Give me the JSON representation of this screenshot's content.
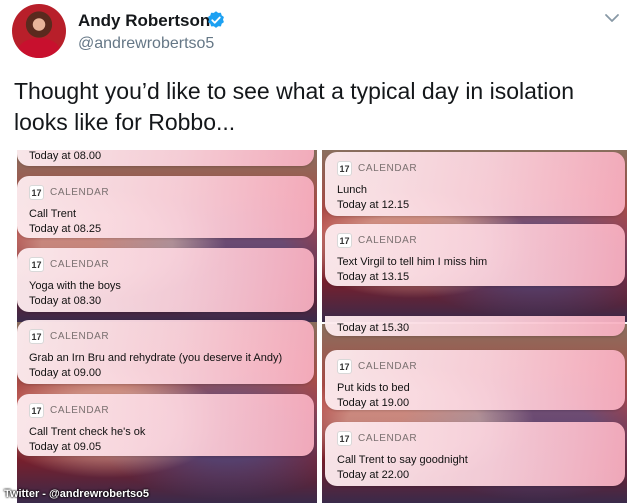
{
  "profile": {
    "name": "Andy Robertson",
    "handle": "@andrewrobertso5",
    "verified_icon": "verified-badge-icon",
    "menu_icon": "chevron-down-icon"
  },
  "tweet": {
    "text": "Thought you’d like to see what a typical day in isolation looks like for Robbo..."
  },
  "media": {
    "watermark": "Twitter - @andrewrobertso5",
    "left_column": [
      {
        "partial": true,
        "time": "Today at 08.00"
      },
      {
        "app": "CALENDAR",
        "day": "17",
        "title": "Call Trent",
        "time": "Today at 08.25"
      },
      {
        "app": "CALENDAR",
        "day": "17",
        "title": "Yoga with the boys",
        "time": "Today at 08.30"
      },
      {
        "app": "CALENDAR",
        "day": "17",
        "title": "Grab an Irn Bru and rehydrate (you deserve it Andy)",
        "time": "Today at 09.00"
      },
      {
        "app": "CALENDAR",
        "day": "17",
        "title": "Call Trent check he's ok",
        "time": "Today at 09.05"
      }
    ],
    "right_column": [
      {
        "app": "CALENDAR",
        "day": "17",
        "title": "Lunch",
        "time": "Today at 12.15"
      },
      {
        "app": "CALENDAR",
        "day": "17",
        "title": "Text Virgil to tell him I miss him",
        "time": "Today at 13.15"
      },
      {
        "partial": true,
        "time": "Today at 15.30"
      },
      {
        "app": "CALENDAR",
        "day": "17",
        "title": "Put kids to bed",
        "time": "Today at 19.00"
      },
      {
        "app": "CALENDAR",
        "day": "17",
        "title": "Call Trent to say goodnight",
        "time": "Today at 22.00"
      }
    ]
  }
}
